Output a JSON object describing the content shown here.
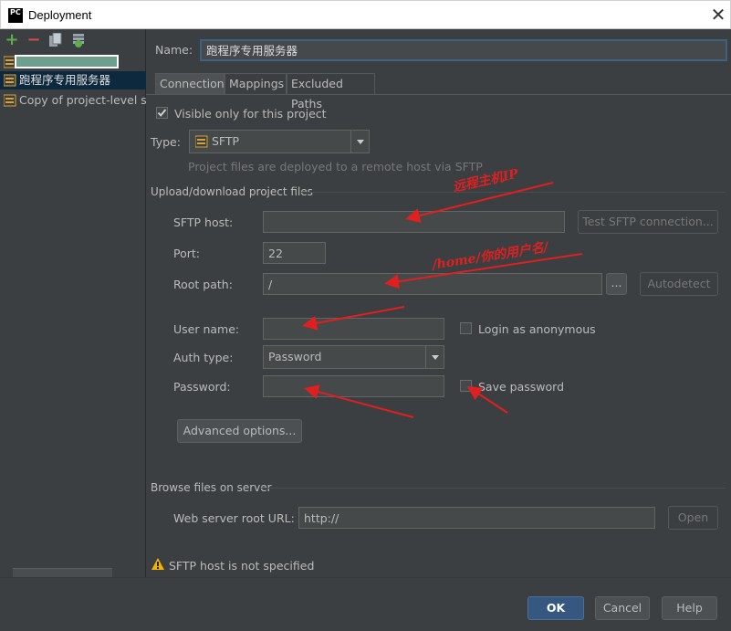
{
  "window": {
    "title": "Deployment",
    "app_icon": "PC",
    "close_label": "✕"
  },
  "sidebar": {
    "tools": [
      "add-icon",
      "remove-icon",
      "copy-icon",
      "set-default-icon"
    ],
    "items": [
      {
        "label": ""
      },
      {
        "label": "跑程序专用服务器",
        "selected": true
      },
      {
        "label": "Copy of project-level se"
      }
    ]
  },
  "form": {
    "name_label": "Name:",
    "name_value": "跑程序专用服务器",
    "tabs": [
      "Connection",
      "Mappings",
      "Excluded Paths"
    ],
    "visible_only_label": "Visible only for this project",
    "visible_only_checked": true,
    "type_label": "Type:",
    "type_value": "SFTP",
    "type_hint": "Project files are deployed to a remote host via SFTP",
    "upload_section": "Upload/download project files",
    "sftp_host_label": "SFTP host:",
    "sftp_host_value": "",
    "test_connection_label": "Test SFTP connection...",
    "port_label": "Port:",
    "port_value": "22",
    "root_path_label": "Root path:",
    "root_path_value": "/",
    "browse_label": "...",
    "autodetect_label": "Autodetect",
    "user_name_label": "User name:",
    "user_name_value": "",
    "login_anonymous_label": "Login as anonymous",
    "auth_type_label": "Auth type:",
    "auth_type_value": "Password",
    "password_label": "Password:",
    "password_value": "",
    "save_password_label": "Save password",
    "advanced_options_label": "Advanced options...",
    "browse_section": "Browse files on server",
    "web_root_label": "Web server root URL:",
    "web_root_value": "http://",
    "open_label": "Open",
    "warning_text": "SFTP host is not specified"
  },
  "annotations": {
    "remote_host": "远程主机IP",
    "home_path": "/home/你的用户名/"
  },
  "footer": {
    "ok": "OK",
    "cancel": "Cancel",
    "help": "Help"
  },
  "colors": {
    "accent": "#365880",
    "selection": "#0d293e",
    "annotation": "#e02020",
    "warning": "#f0b400"
  }
}
